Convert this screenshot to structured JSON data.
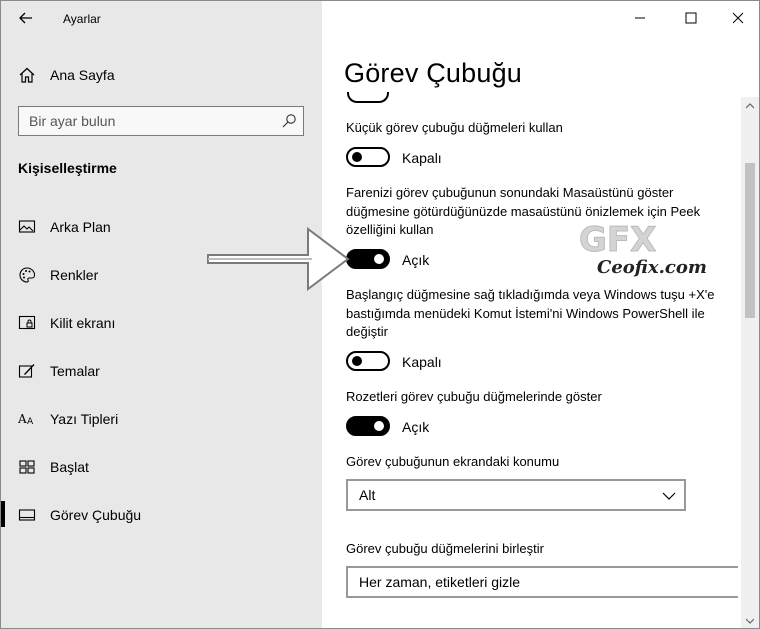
{
  "window": {
    "title": "Ayarlar",
    "caption": {
      "minimize_icon": "minimize-icon",
      "maximize_icon": "maximize-icon",
      "close_icon": "close-icon"
    }
  },
  "sidebar": {
    "home_label": "Ana Sayfa",
    "search_placeholder": "Bir ayar bulun",
    "section_title": "Kişiselleştirme",
    "items": [
      {
        "label": "Arka Plan",
        "icon": "picture-icon",
        "active": false
      },
      {
        "label": "Renkler",
        "icon": "palette-icon",
        "active": false
      },
      {
        "label": "Kilit ekranı",
        "icon": "lock-screen-icon",
        "active": false
      },
      {
        "label": "Temalar",
        "icon": "themes-icon",
        "active": false
      },
      {
        "label": "Yazı Tipleri",
        "icon": "fonts-icon",
        "active": false
      },
      {
        "label": "Başlat",
        "icon": "start-icon",
        "active": false
      },
      {
        "label": "Görev Çubuğu",
        "icon": "taskbar-icon",
        "active": true
      }
    ]
  },
  "main": {
    "title": "Görev Çubuğu",
    "settings": [
      {
        "text": "Küçük görev çubuğu düğmeleri kullan",
        "state": "Kapalı",
        "on": false
      },
      {
        "text": "Farenizi görev çubuğunun sonundaki Masaüstünü göster düğmesine götürdüğünüzde masaüstünü önizlemek için Peek özelliğini kullan",
        "state": "Açık",
        "on": true
      },
      {
        "text": "Başlangıç düğmesine sağ tıkladığımda veya Windows tuşu +X'e bastığımda menüdeki Komut İstemi'ni Windows PowerShell ile değiştir",
        "state": "Kapalı",
        "on": false
      },
      {
        "text": "Rozetleri görev çubuğu düğmelerinde göster",
        "state": "Açık",
        "on": true
      }
    ],
    "position": {
      "label": "Görev çubuğunun ekrandaki konumu",
      "value": "Alt"
    },
    "combine": {
      "label": "Görev çubuğu düğmelerini birleştir",
      "value": "Her zaman, etiketleri gizle"
    }
  },
  "watermark": {
    "text": "Ceofix.com",
    "logo_text": "GFX"
  },
  "colors": {
    "sidebar_bg": "#e8e8e8",
    "toggle_on": "#000000",
    "main_bg": "#ffffff"
  }
}
